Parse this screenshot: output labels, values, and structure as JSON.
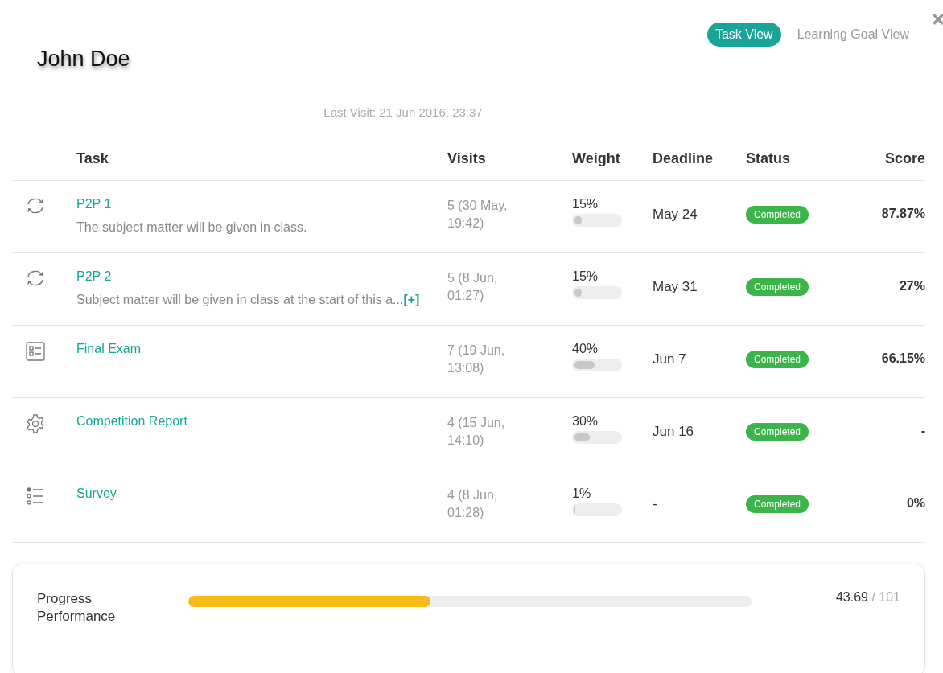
{
  "student": {
    "name": "John Doe"
  },
  "view_tabs": [
    {
      "label": "Task View",
      "selected": true
    },
    {
      "label": "Learning Goal View",
      "selected": false
    }
  ],
  "last_visit": "Last Visit: 21 Jun 2016, 23:37",
  "table": {
    "columns": [
      "Task",
      "Visits",
      "Weight",
      "Deadline",
      "Status",
      "Score"
    ],
    "rows": [
      {
        "kind": "refresh",
        "task": "P2P 1",
        "description": "The subject matter will be given in class.",
        "expand": "",
        "visits": "5 (30 May, 19:42)",
        "weight": "15%",
        "level": 0.15,
        "deadline": "May 24",
        "status": "Completed",
        "score": "87.87%"
      },
      {
        "kind": "refresh",
        "task": "P2P 2",
        "description": "Subject matter will be given in class at the start of this a...",
        "expand": "[+]",
        "visits": "5 (8 Jun, 01:27)",
        "weight": "15%",
        "level": 0.15,
        "deadline": "May 31",
        "status": "Completed",
        "score": "27%"
      },
      {
        "kind": "form",
        "task": "Final Exam",
        "description": "",
        "expand": "",
        "visits": "7 (19 Jun, 13:08)",
        "weight": "40%",
        "level": 0.4,
        "deadline": "Jun 7",
        "status": "Completed",
        "score": "66.15%"
      },
      {
        "kind": "gear",
        "task": "Competition Report",
        "description": "",
        "expand": "",
        "visits": "4 (15 Jun, 14:10)",
        "weight": "30%",
        "level": 0.3,
        "deadline": "Jun 16",
        "status": "Completed",
        "score": "-"
      },
      {
        "kind": "list",
        "task": "Survey",
        "description": "",
        "expand": "",
        "visits": "4 (8 Jun, 01:28)",
        "weight": "1%",
        "level": 0.01,
        "deadline": "-",
        "status": "Completed",
        "score": "0%"
      }
    ]
  },
  "progress": {
    "label": "Progress Performance",
    "level": 0.43,
    "value": "43.69",
    "total": "/ 101"
  }
}
